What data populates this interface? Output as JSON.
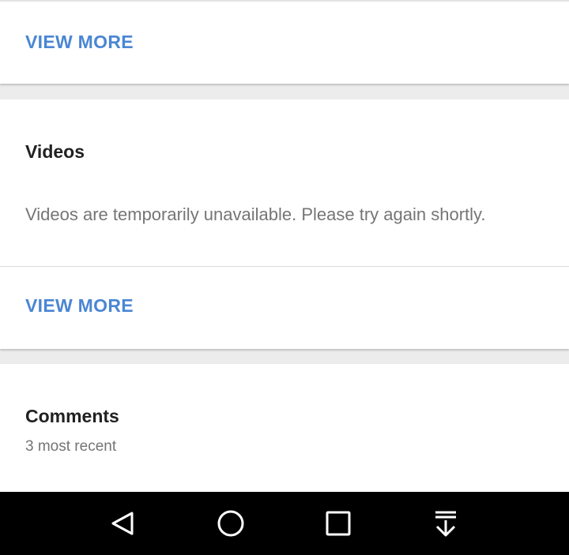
{
  "top_card": {
    "view_more_label": "VIEW MORE"
  },
  "videos": {
    "title": "Videos",
    "message": "Videos are temporarily unavailable. Please try again shortly.",
    "view_more_label": "VIEW MORE"
  },
  "comments": {
    "title": "Comments",
    "subtitle": "3 most recent"
  },
  "navbar": {
    "buttons": [
      {
        "icon": "back-triangle-icon"
      },
      {
        "icon": "home-circle-icon"
      },
      {
        "icon": "recents-square-icon"
      },
      {
        "icon": "notification-pulldown-icon"
      }
    ]
  },
  "colors": {
    "accent": "#4a86d4",
    "title_text": "#212121",
    "secondary_text": "#757575",
    "navbar": "#000000"
  }
}
